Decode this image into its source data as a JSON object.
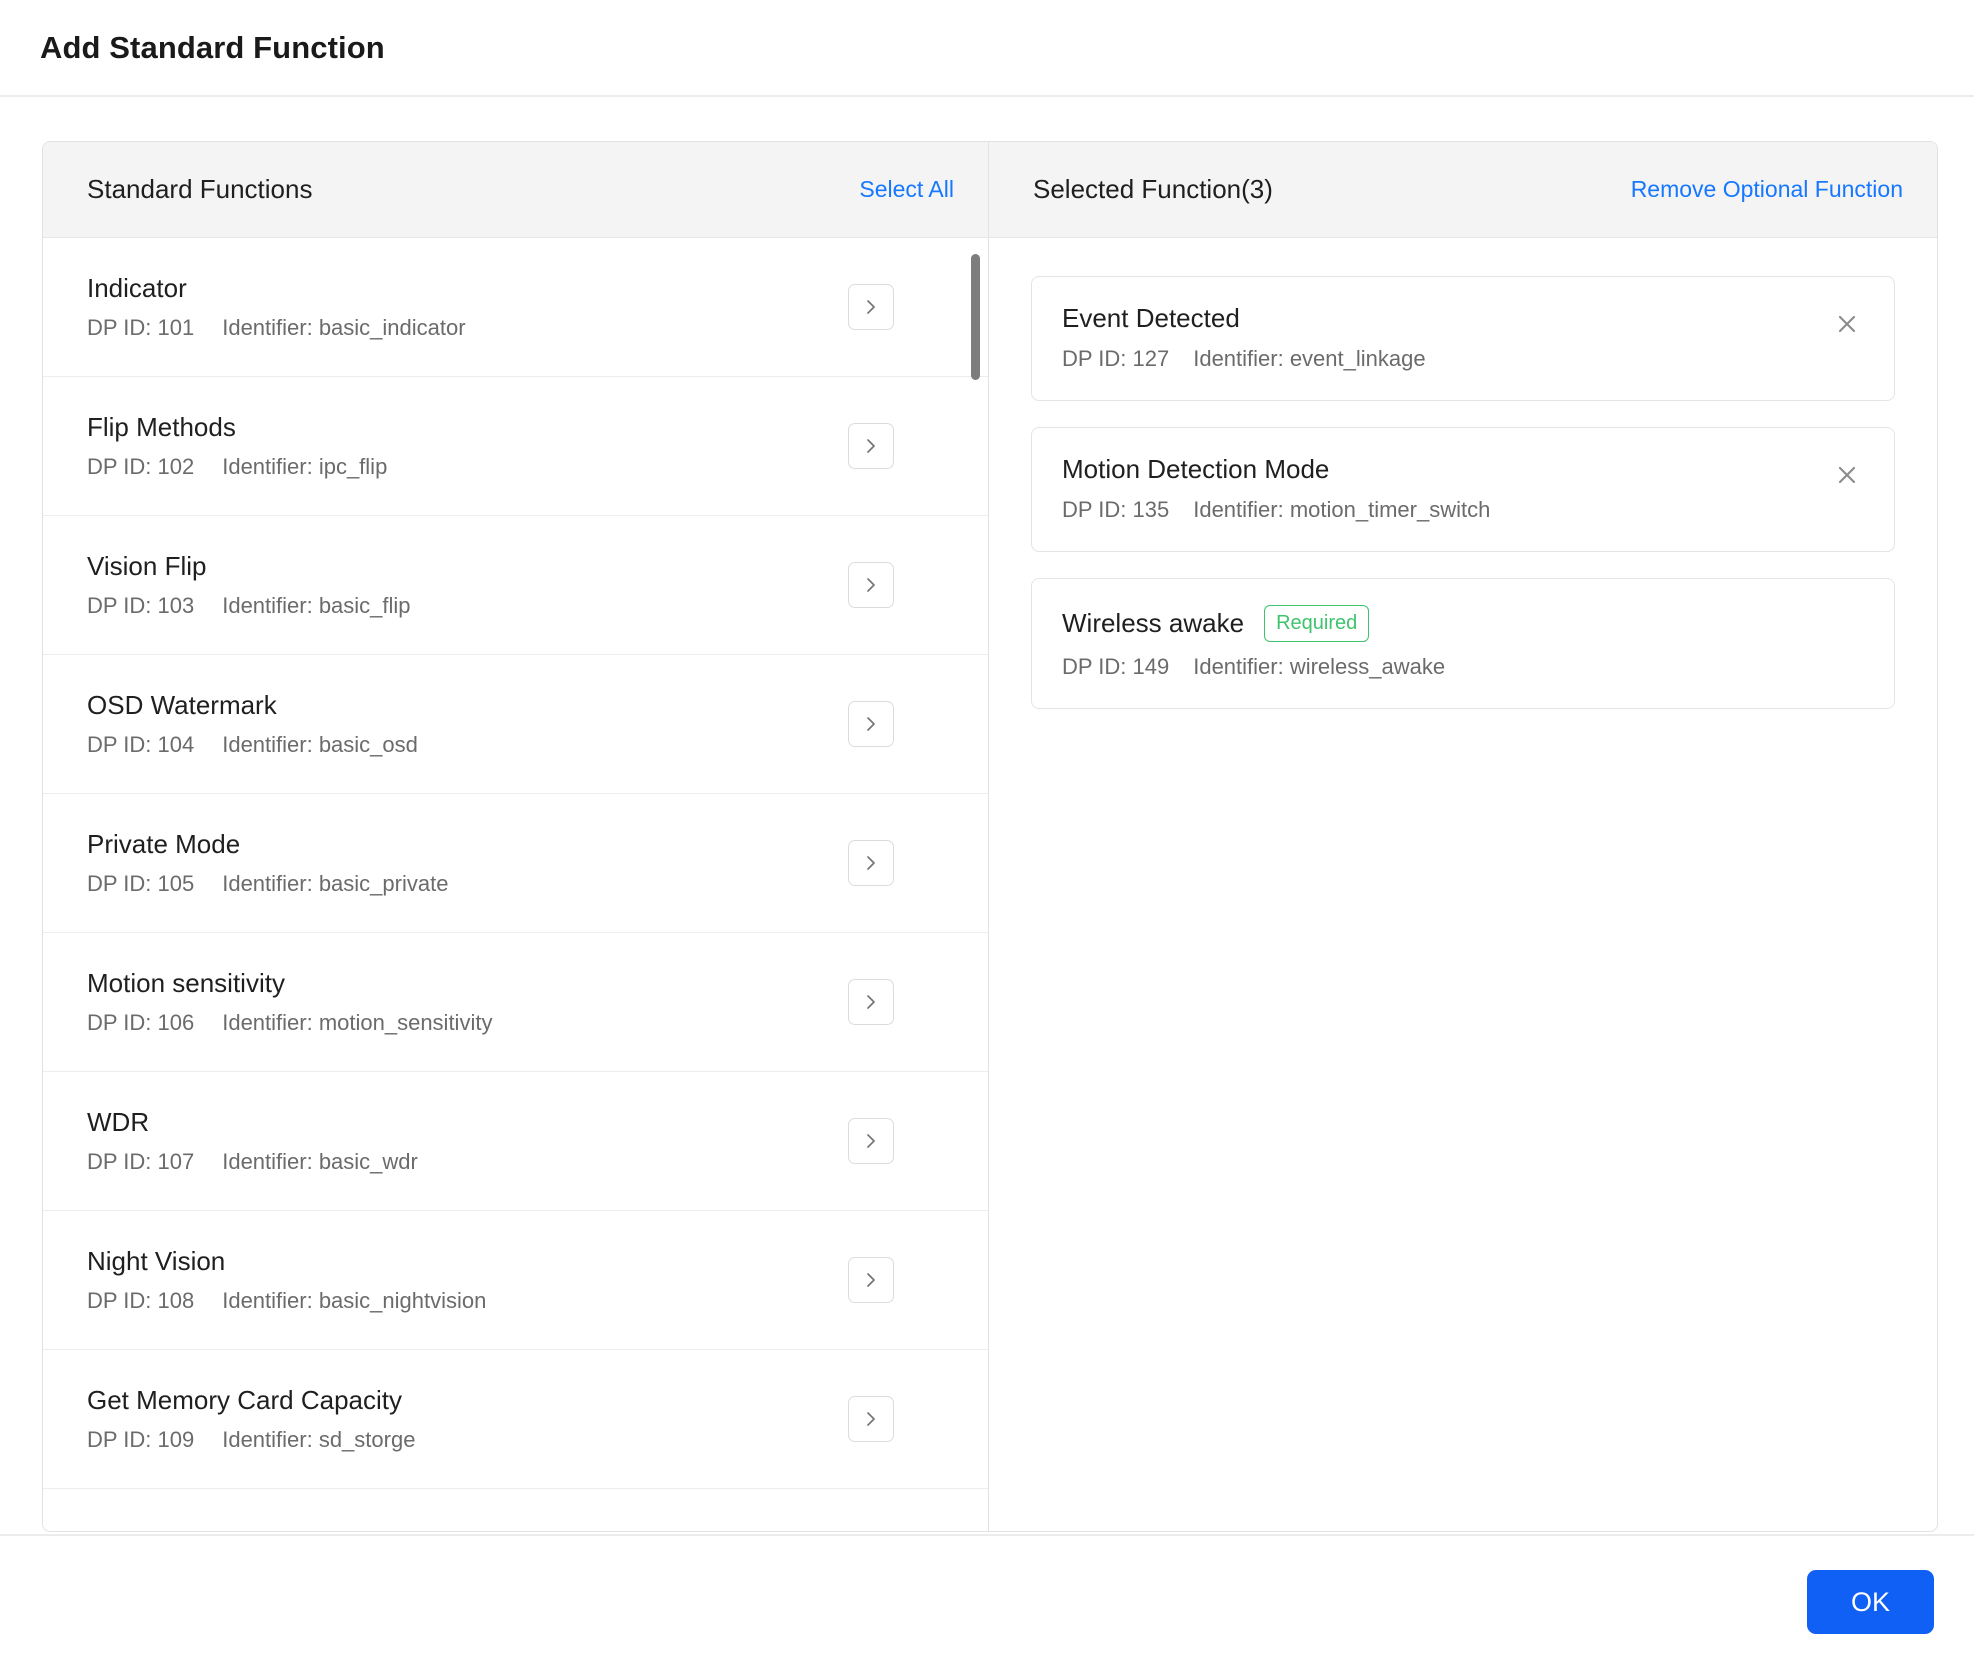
{
  "dialog": {
    "title": "Add Standard Function",
    "ok_label": "OK"
  },
  "left_panel": {
    "title": "Standard Functions",
    "action_label": "Select All",
    "dp_id_prefix": "DP ID:",
    "identifier_prefix": "Identifier:",
    "add_icon": "chevron-right-icon",
    "items": [
      {
        "name": "Indicator",
        "dp_id": "DP ID: 101",
        "identifier": "Identifier: basic_indicator"
      },
      {
        "name": "Flip Methods",
        "dp_id": "DP ID: 102",
        "identifier": "Identifier: ipc_flip"
      },
      {
        "name": "Vision Flip",
        "dp_id": "DP ID: 103",
        "identifier": "Identifier: basic_flip"
      },
      {
        "name": "OSD Watermark",
        "dp_id": "DP ID: 104",
        "identifier": "Identifier: basic_osd"
      },
      {
        "name": "Private Mode",
        "dp_id": "DP ID: 105",
        "identifier": "Identifier: basic_private"
      },
      {
        "name": "Motion sensitivity",
        "dp_id": "DP ID: 106",
        "identifier": "Identifier: motion_sensitivity"
      },
      {
        "name": "WDR",
        "dp_id": "DP ID: 107",
        "identifier": "Identifier: basic_wdr"
      },
      {
        "name": "Night Vision",
        "dp_id": "DP ID: 108",
        "identifier": "Identifier: basic_nightvision"
      },
      {
        "name": "Get Memory Card Capacity",
        "dp_id": "DP ID: 109",
        "identifier": "Identifier: sd_storge"
      }
    ]
  },
  "right_panel": {
    "title": "Selected Function(3)",
    "action_label": "Remove Optional Function",
    "selected_count": 3,
    "remove_icon": "close-icon",
    "items": [
      {
        "name": "Event Detected",
        "dp_id": "DP ID: 127",
        "identifier": "Identifier: event_linkage",
        "badge": null,
        "removable": true
      },
      {
        "name": "Motion Detection Mode",
        "dp_id": "DP ID: 135",
        "identifier": "Identifier: motion_timer_switch",
        "badge": null,
        "removable": true
      },
      {
        "name": "Wireless awake",
        "dp_id": "DP ID: 149",
        "identifier": "Identifier: wireless_awake",
        "badge": "Required",
        "removable": false
      }
    ]
  },
  "colors": {
    "link": "#1677ff",
    "primary_button": "#1160f5",
    "required_badge": "#3ec46d",
    "panel_header_bg": "#f4f4f5",
    "border": "#e2e2e2",
    "text": "#1f1f1f",
    "muted_text": "#6b6b6b",
    "scrollbar_thumb": "#7d7d7d"
  }
}
